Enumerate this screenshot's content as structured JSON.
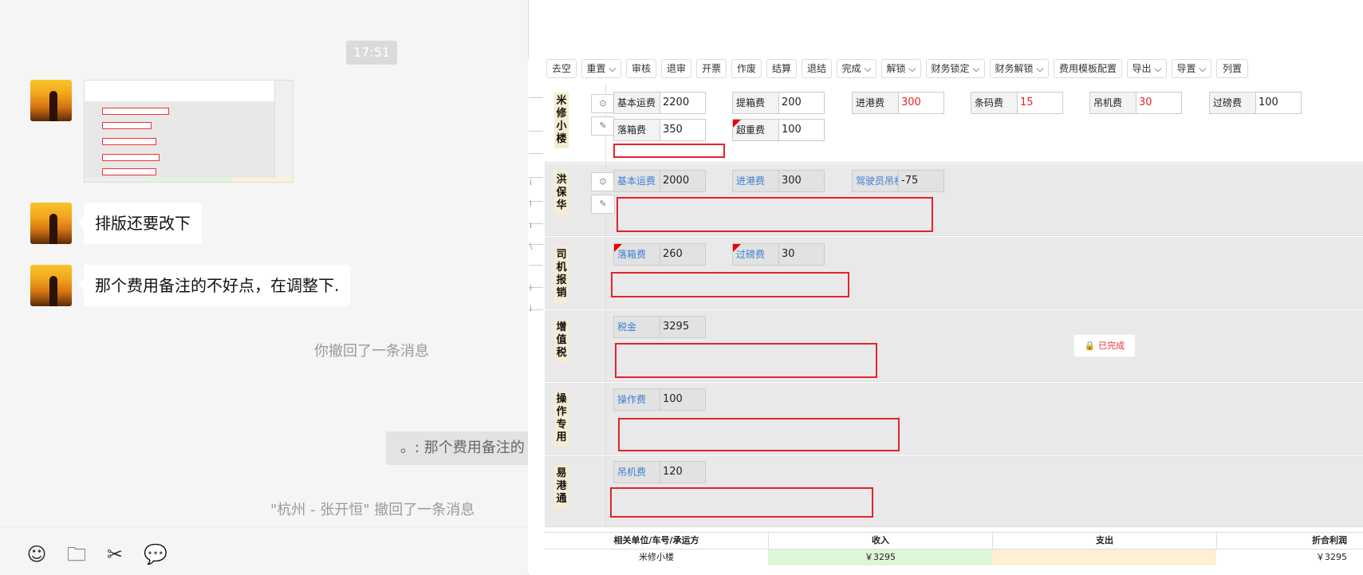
{
  "chat": {
    "time": "17:51",
    "messages": [
      {
        "type": "image",
        "alt": ""
      },
      {
        "type": "text",
        "text": "排版还要改下"
      },
      {
        "type": "text",
        "text": "那个费用备注的不好点，在调整下."
      }
    ],
    "recall_self": "你撤回了一条消息",
    "quote": "。: 那个费用备注的",
    "recall_other": "\"杭州 - 张开恒\" 撤回了一条消息",
    "toolbar_icons": [
      "emoji-icon",
      "folder-icon",
      "scissors-icon",
      "chat-bubble-icon"
    ],
    "toolbar_glyphs": [
      "☺",
      "🗀",
      "✂",
      "💬"
    ]
  },
  "erp": {
    "strip_letters": [
      "i",
      "i",
      "i",
      "\\",
      "i",
      "i"
    ],
    "toolbar": [
      "去空",
      "重置 ⌵",
      "审核",
      "退审",
      "开票",
      "作废",
      "结算",
      "退结",
      "完成 ⌵",
      "解锁 ⌵",
      "财务锁定 ⌵",
      "财务解锁 ⌵",
      "费用模板配置",
      "导出 ⌵",
      "导置 ⌵",
      "列置"
    ],
    "sections": [
      {
        "label": "米修小楼",
        "fields": [
          {
            "label": "基本运费",
            "value": "2200"
          },
          {
            "label": "提箱费",
            "value": "200"
          },
          {
            "label": "进港费",
            "value": "300"
          },
          {
            "label": "条码费",
            "value": "15"
          },
          {
            "label": "吊机费",
            "value": "30"
          },
          {
            "label": "过磅费",
            "value": "100"
          },
          {
            "label": "落箱费",
            "value": "350"
          },
          {
            "label": "超重费",
            "value": "100"
          }
        ]
      },
      {
        "label": "洪保华",
        "fields": [
          {
            "label": "基本运费",
            "value": "2000"
          },
          {
            "label": "进港费",
            "value": "300"
          },
          {
            "label": "驾驶员吊机",
            "value": "-75"
          }
        ]
      },
      {
        "label": "司机报销",
        "fields": [
          {
            "label": "落箱费",
            "value": "260"
          },
          {
            "label": "过磅费",
            "value": "30"
          }
        ]
      },
      {
        "label": "增值税",
        "fields": [
          {
            "label": "税金",
            "value": "3295"
          }
        ]
      },
      {
        "label": "操作专用",
        "fields": [
          {
            "label": "操作费",
            "value": "100"
          }
        ]
      },
      {
        "label": "易港通",
        "fields": [
          {
            "label": "吊机费",
            "value": "120"
          }
        ]
      }
    ],
    "status_badge": "🔒 已完成",
    "summary": {
      "headers": [
        "相关单位/车号/承运方",
        "收入",
        "支出",
        "折合利润"
      ],
      "row": [
        "米修小楼",
        "￥3295",
        "",
        "￥3295"
      ]
    },
    "colors": {
      "red_text": "#e22222",
      "blue_label": "#3c7fd4",
      "highlight_box": "#e4232b",
      "income_bg": "#dff5d9",
      "expense_bg": "#fdf0d5"
    }
  }
}
